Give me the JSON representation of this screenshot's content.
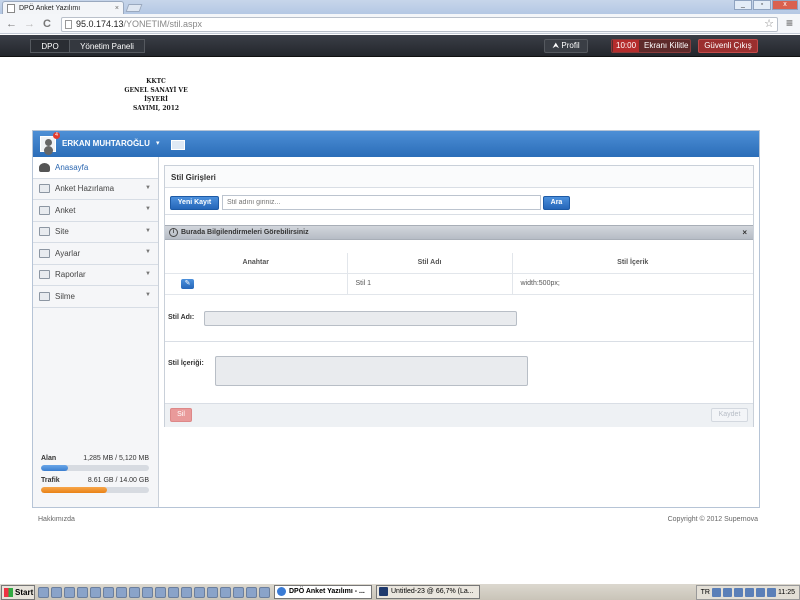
{
  "browser": {
    "tab_title": "DPÖ Anket Yazılımı",
    "tab_close": "×",
    "url_host": "95.0.174.13",
    "url_path": "/YONETIM/stil.aspx",
    "back": "←",
    "forward": "→",
    "reload": "C",
    "star": "☆",
    "menu": "≡",
    "win_min": "_",
    "win_max": "▫",
    "win_close": "x"
  },
  "header": {
    "crumb_root": "DPO",
    "crumb_current": "Yönetim Paneli",
    "profile_label": "Profil",
    "lock_time": "10:00",
    "lock_label": "Ekranı Kilitle",
    "exit_label": "Güvenli Çıkış"
  },
  "logo": {
    "line1": "KKTC",
    "line2": "GENEL SANAYİ VE İŞYERİ",
    "line3": "SAYIMI, 2012"
  },
  "user": {
    "name": "ERKAN MUHTAROĞLU",
    "notifications": "4",
    "chevron": "▾"
  },
  "sidebar": {
    "items": [
      {
        "label": "Anasayfa",
        "chevron": ""
      },
      {
        "label": "Anket Hazırlama",
        "chevron": "▼"
      },
      {
        "label": "Anket",
        "chevron": "▼"
      },
      {
        "label": "Site",
        "chevron": "▼"
      },
      {
        "label": "Ayarlar",
        "chevron": "▼"
      },
      {
        "label": "Raporlar",
        "chevron": "▼"
      },
      {
        "label": "Silme",
        "chevron": "▼"
      }
    ]
  },
  "usage": {
    "disk_label": "Alan",
    "disk_value": "1,285 MB / 5,120 MB",
    "disk_fraction": 0.25,
    "traffic_label": "Trafik",
    "traffic_value": "8.61 GB / 14.00 GB",
    "traffic_fraction": 0.615
  },
  "content": {
    "title": "Stil Girişleri",
    "new_button": "Yeni Kayıt",
    "search_placeholder": "Stil adını giriniz...",
    "search_button": "Ara",
    "info_icon": "i",
    "info_text": "Burada Bilgilendirmeleri Görebilirsiniz",
    "info_close": "×",
    "table": {
      "headers": [
        "Anahtar",
        "Stil Adı",
        "Stil İçerik"
      ],
      "edit_icon": "✎",
      "rows": [
        {
          "name": "Stil 1",
          "content": "width:500px;"
        }
      ]
    },
    "name_label": "Stil Adı:",
    "content_label": "Stil İçeriği:",
    "delete_button": "Sil",
    "save_button": "Kaydet"
  },
  "footer": {
    "about": "Hakkımızda",
    "copyright": "Copyright © 2012 Supernova"
  },
  "taskbar": {
    "start": "Start",
    "task1": "DPÖ Anket Yazılımı - ...",
    "task2": "Untitled-23 @ 66,7% (La...",
    "clock": "11:25",
    "tray_lang": "TR"
  }
}
